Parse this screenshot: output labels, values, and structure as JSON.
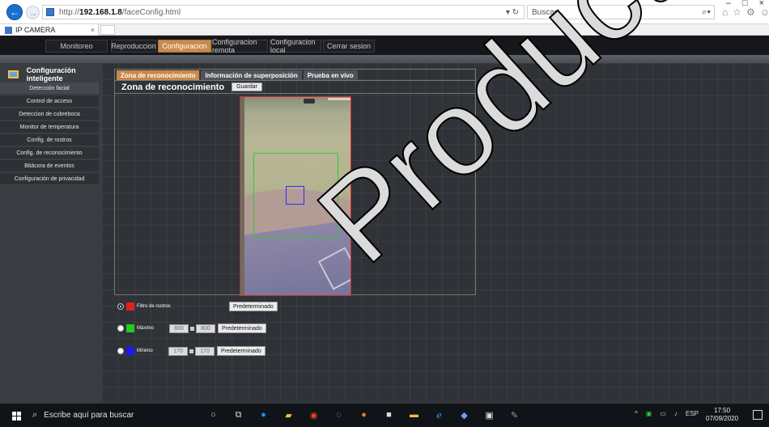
{
  "browser": {
    "url_prefix": "http://",
    "url_host": "192.168.1.8",
    "url_path": "/faceConfig.html",
    "search_placeholder": "Buscar...",
    "tab_title": "IP CAMERA",
    "tab_close": "×"
  },
  "nav": {
    "items": [
      {
        "label": "Monitoreo"
      },
      {
        "label": "Reproduccion"
      },
      {
        "label": "Configuracion"
      },
      {
        "label": "Configuracion remota"
      },
      {
        "label": "Configuracion local"
      },
      {
        "label": "Cerrar sesion"
      }
    ],
    "active_index": 2
  },
  "sidebar": {
    "title": "Configuración inteligente",
    "items": [
      {
        "label": "Detección facial"
      },
      {
        "label": "Control de acceso"
      },
      {
        "label": "Deteccion de cubreboca"
      },
      {
        "label": "Monitor de temperatura"
      },
      {
        "label": "Config. de rostros"
      },
      {
        "label": "Config. de reconocimiento"
      },
      {
        "label": "Bitácora de eventos"
      },
      {
        "label": "Configuración de privacidad"
      }
    ]
  },
  "content": {
    "subtabs": [
      {
        "label": "Zona de reconocimiento"
      },
      {
        "label": "Información de superposición"
      },
      {
        "label": "Prueba en vivo"
      }
    ],
    "title": "Zona de reconocimiento",
    "save_label": "Guardar",
    "filters": {
      "face_filter": {
        "label": "Filtro de rostros",
        "button": "Predeterminado",
        "color": "#e02020"
      },
      "max": {
        "label": "Máximo",
        "w": "800",
        "h": "800",
        "button": "Predeterminado",
        "color": "#22cc22"
      },
      "min": {
        "label": "Mínimo",
        "w": "170",
        "h": "170",
        "button": "Predeterminado",
        "color": "#1a1aff"
      }
    }
  },
  "taskbar": {
    "search_text": "Escribe aquí para buscar",
    "lang": "ESP",
    "time": "17:50",
    "date": "07/09/2020"
  },
  "watermark": "Products S.A."
}
